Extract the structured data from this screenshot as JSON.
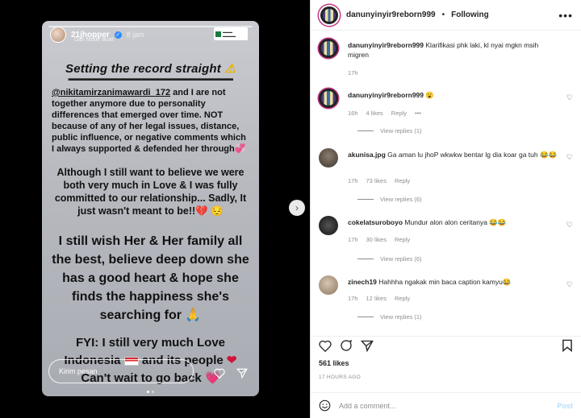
{
  "story": {
    "username": "21jhopper",
    "time": "8 jam",
    "subtitle": "Dari Mode Buat",
    "headline": "Setting the record straight",
    "dashes": "▬▬▬▬▬▬▬▬▬▬▬▬▬▬▬▬▬▬▬▬▬▬▬▬",
    "mention": "@nikitamirzanimawardi_172",
    "para1_rest": " and I are not together anymore due to personality differences that emerged over time. NOT because of any of her legal issues, distance, public influence, or negative comments which I always supported & defended her through",
    "para2": "Although I still want to believe we were both very much in Love & I was fully committed to our relationship... Sadly, It just wasn't meant to be!!",
    "para3": "I still wish Her & Her family all the best, believe deep down she has a good heart & hope she finds the happiness she's searching for",
    "para4a": "FYI: I still very much Love",
    "para4b": "Indonesia",
    "para4c": "and its people",
    "para4d": "Can't wait to go back",
    "reply_placeholder": "Kirim pesan"
  },
  "post": {
    "username": "danunyinyir9reborn999",
    "separator": "•",
    "following": "Following",
    "more": "•••",
    "caption_user": "danunyinyir9reborn999",
    "caption_text": "Klarifikasi phk laki, kl nyai mgkn msih migren",
    "caption_time": "17h",
    "likes": "561 likes",
    "time_ago": "17 HOURS AGO",
    "add_comment": "Add a comment...",
    "post_button": "Post"
  },
  "comments": [
    {
      "user": "danunyinyir9reborn999",
      "text": "😮",
      "time": "16h",
      "likes": "4 likes",
      "reply": "Reply",
      "extra": "•••",
      "view": "View replies (1)"
    },
    {
      "user": "akunisa.jpg",
      "text": "Ga aman lu jhoP wkwkw bentar lg dia koar ga tuh 😂😂",
      "time": "17h",
      "likes": "73 likes",
      "reply": "Reply",
      "view": "View replies (6)"
    },
    {
      "user": "cokelatsuroboyo",
      "text": "Mundur alon alon ceritanya 😂😂",
      "time": "17h",
      "likes": "30 likes",
      "reply": "Reply",
      "view": "View replies (6)"
    },
    {
      "user": "zinech19",
      "text": "Hahhha ngakak min baca caption kamyu😂",
      "time": "17h",
      "likes": "12 likes",
      "reply": "Reply",
      "view": "View replies (1)"
    }
  ]
}
